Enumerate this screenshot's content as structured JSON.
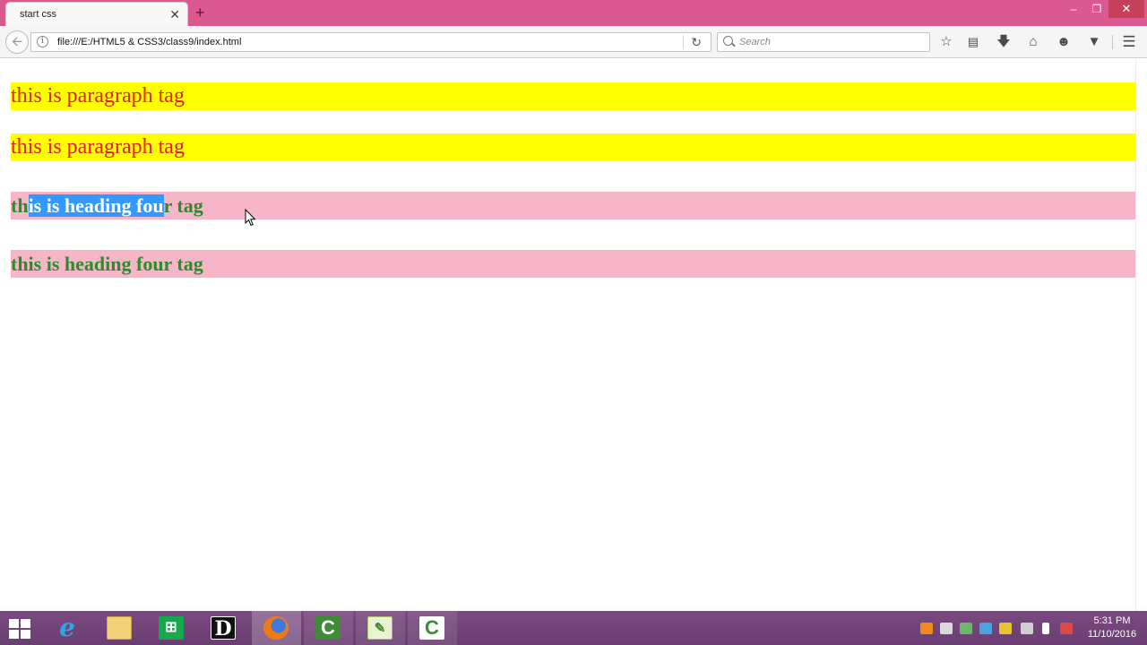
{
  "browser": {
    "tab_title": "start css",
    "tab_close": "✕",
    "new_tab": "+",
    "window_controls": {
      "minimize": "‒",
      "maximize": "❐",
      "close": "✕"
    },
    "url": "file:///E:/HTML5 & CSS3/class9/index.html",
    "search_placeholder": "Search",
    "icons": [
      "back-icon",
      "info-icon",
      "reload-icon",
      "search-icon",
      "star-icon",
      "reading-list-icon",
      "download-icon",
      "home-icon",
      "chat-icon",
      "pocket-icon",
      "menu-icon"
    ]
  },
  "page": {
    "paragraphs": [
      "this is paragraph tag",
      "this is paragraph tag"
    ],
    "heading_1": {
      "before": "th",
      "selected": "is is heading fou",
      "after": "r tag"
    },
    "heading_2": "this is heading four tag",
    "colors": {
      "paragraph_bg": "#ffff00",
      "paragraph_text": "#e0201b",
      "heading_bg": "#f7b6c8",
      "heading_text": "#2d8a2d",
      "selection": "#3399ff"
    }
  },
  "taskbar": {
    "apps": [
      "windows-start-icon",
      "internet-explorer-icon",
      "file-explorer-icon",
      "store-icon",
      "d-app-icon",
      "firefox-icon",
      "camtasia-icon",
      "notepad-plus-plus-icon",
      "camtasia-recorder-icon"
    ],
    "clock_time": "5:31 PM",
    "clock_date": "11/10/2016"
  }
}
